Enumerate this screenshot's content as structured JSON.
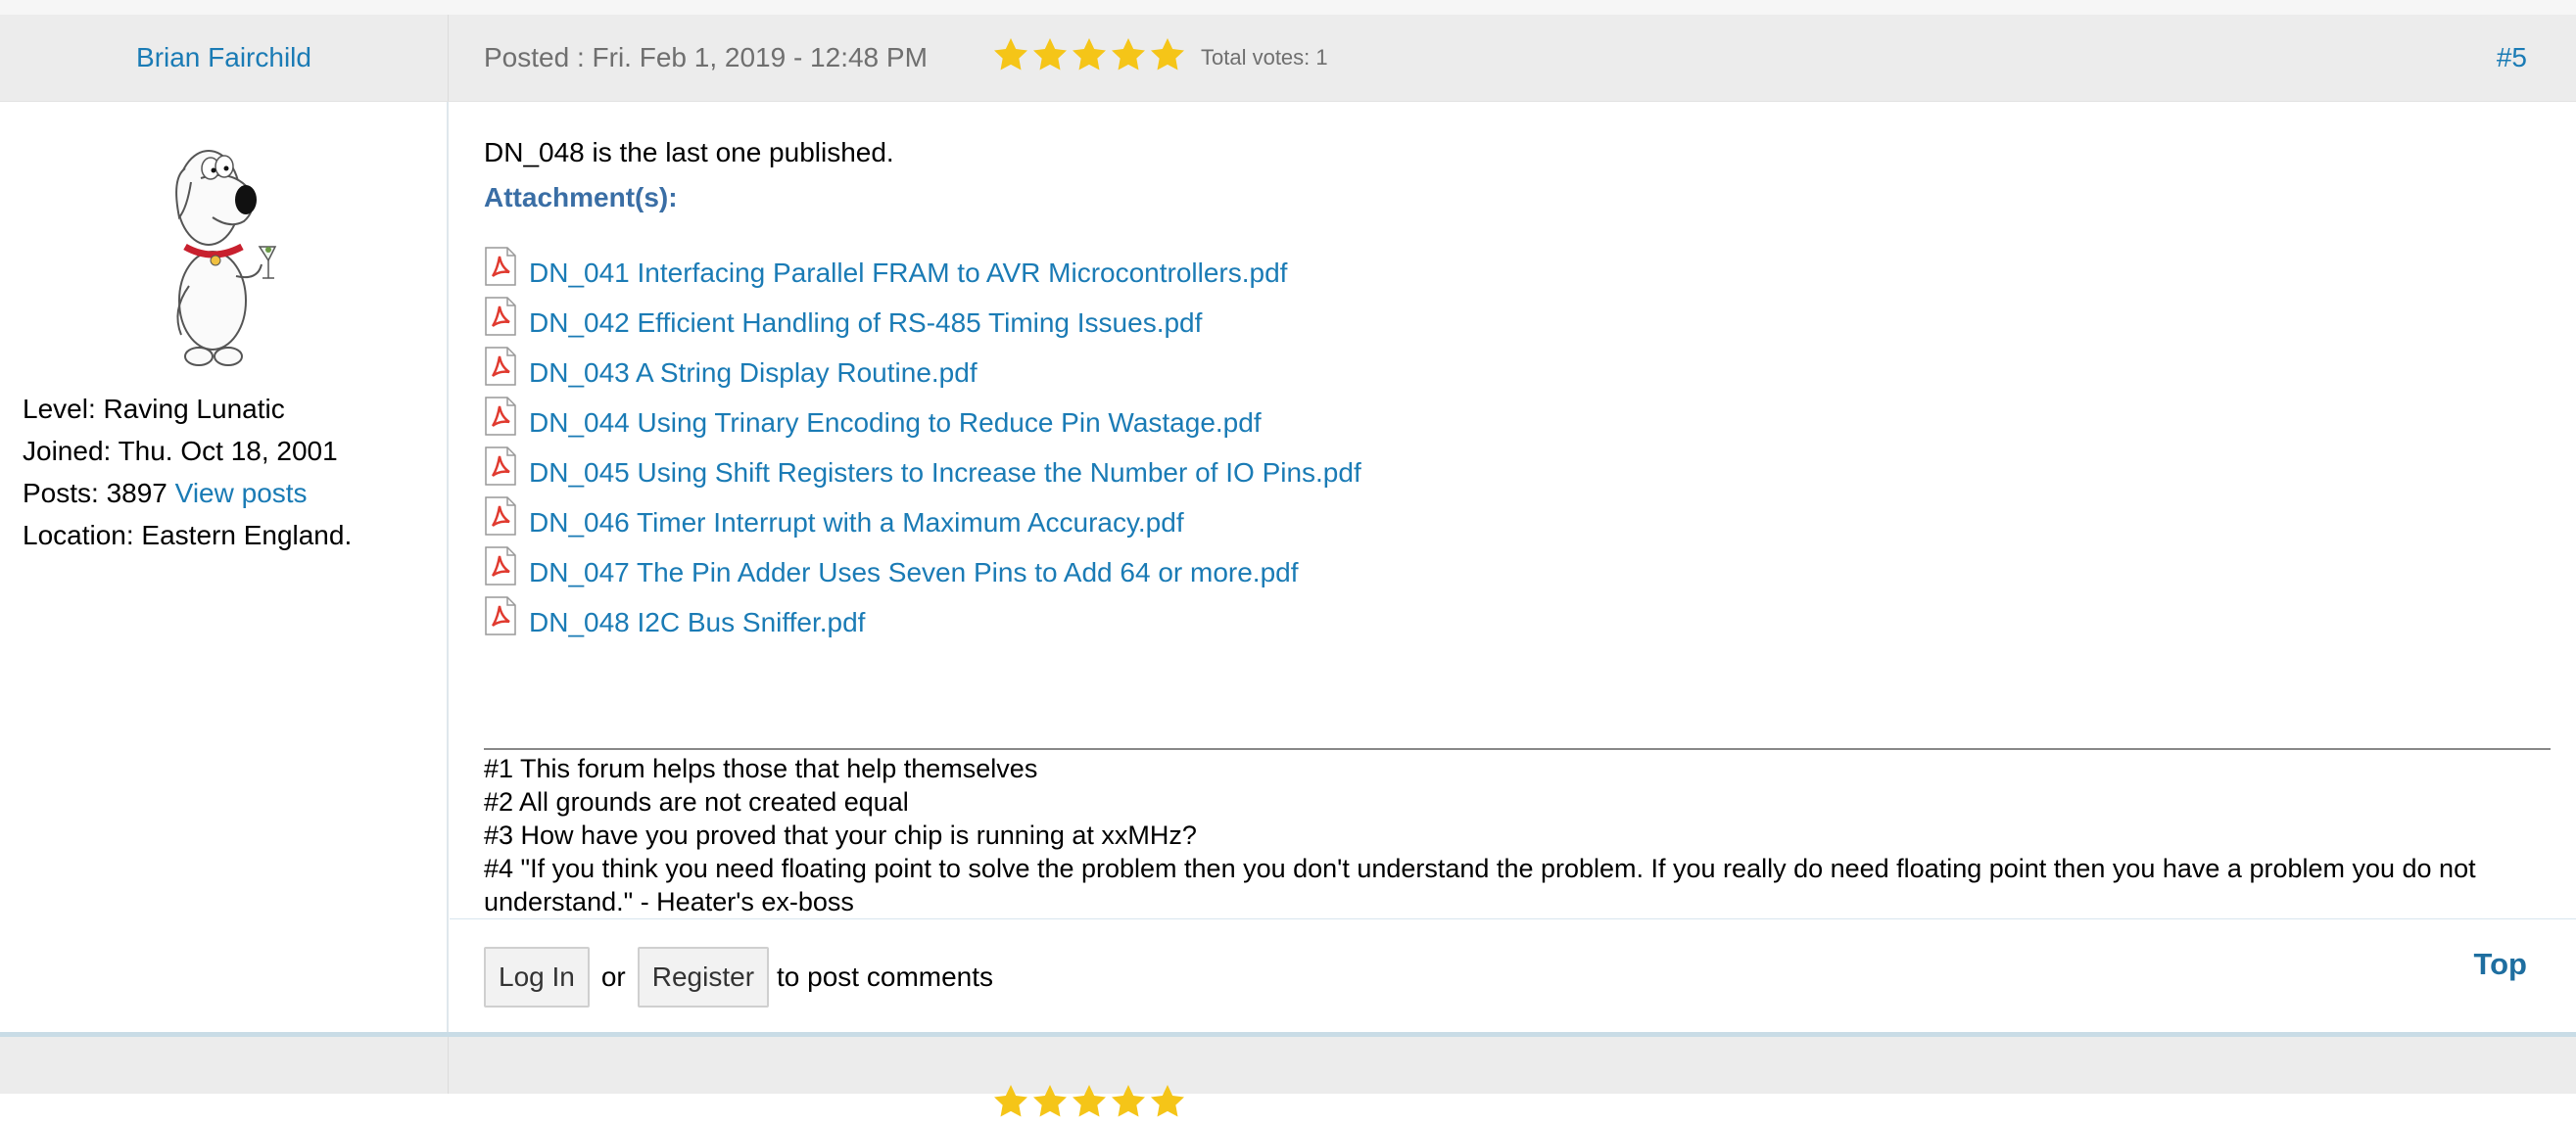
{
  "post": {
    "author": "Brian Fairchild",
    "posted": "Posted : Fri. Feb 1, 2019 - 12:48 PM",
    "rating": 5,
    "total_votes": "Total votes: 1",
    "post_number": "#5",
    "body": "DN_048 is the last one published.",
    "attachments_heading": "Attachment(s):",
    "attachments": [
      "DN_041 Interfacing Parallel FRAM to AVR Microcontrollers.pdf",
      "DN_042 Efficient Handling of RS-485 Timing Issues.pdf",
      "DN_043 A String Display Routine.pdf",
      "DN_044 Using Trinary Encoding to Reduce Pin Wastage.pdf",
      "DN_045 Using Shift Registers to Increase the Number of IO Pins.pdf",
      "DN_046 Timer Interrupt with a Maximum Accuracy.pdf",
      "DN_047 The Pin Adder Uses Seven Pins to Add 64 or more.pdf",
      "DN_048 I2C Bus Sniffer.pdf"
    ],
    "signature": [
      "#1 This forum helps those that help themselves",
      "#2 All grounds are not created equal",
      "#3 How have you proved that your chip is running at xxMHz?",
      "#4 \"If you think you need floating point to solve the problem then you don't understand the problem. If you really do need floating point then you have a problem you do not understand.\" - Heater's ex-boss"
    ]
  },
  "user": {
    "level": "Level: Raving Lunatic",
    "joined": "Joined: Thu. Oct 18, 2001",
    "posts": "Posts: 3897",
    "view_posts": "View posts",
    "location": "Location: Eastern England."
  },
  "footer": {
    "login": "Log In",
    "or": "or",
    "register": "Register",
    "after": "to post comments",
    "top": "Top"
  },
  "icons": {
    "star": "star-icon",
    "attachment": "pdf-file-icon"
  },
  "colors": {
    "link": "#1a7bb5",
    "star": "#f5c518",
    "header_bg": "#ececec"
  }
}
